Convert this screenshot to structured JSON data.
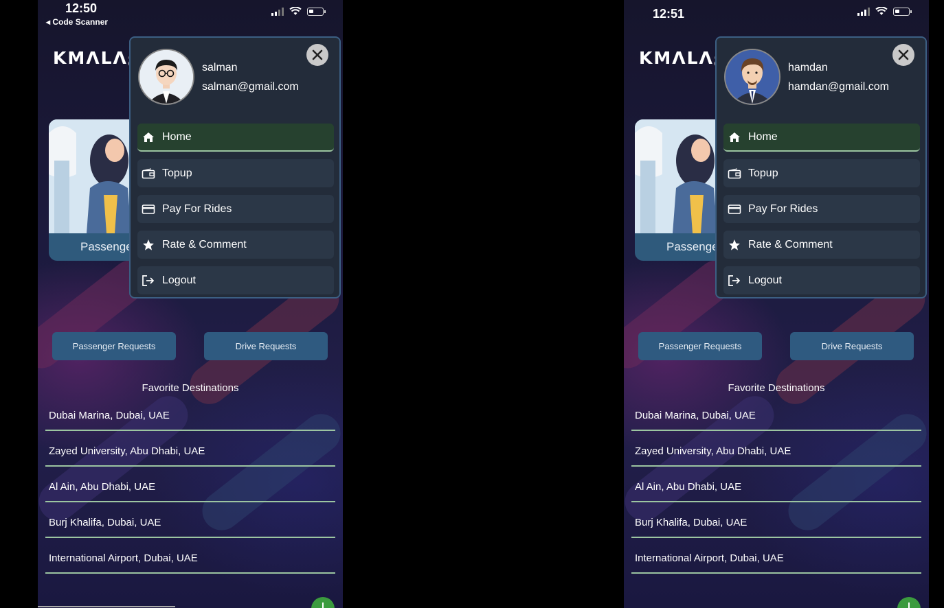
{
  "screens": [
    {
      "status": {
        "time": "12:50",
        "back_label": "◂ Code Scanner"
      },
      "logo": "KMɅLɅꜫ",
      "card_label": "Passenger",
      "drawer": {
        "user_name": "salman",
        "user_email": "salman@gmail.com",
        "close_icon": "close-icon",
        "menu": [
          {
            "label": "Home",
            "icon": "home-icon",
            "active": true
          },
          {
            "label": "Topup",
            "icon": "wallet-icon"
          },
          {
            "label": "Pay For Rides",
            "icon": "credit-card-icon"
          },
          {
            "label": "Rate & Comment",
            "icon": "star-icon"
          },
          {
            "label": "Logout",
            "icon": "logout-icon"
          }
        ]
      },
      "buttons": {
        "passenger_requests": "Passenger Requests",
        "drive_requests": "Drive Requests"
      },
      "favorites_title": "Favorite Destinations",
      "favorites": [
        "Dubai Marina, Dubai, UAE",
        "Zayed University, Abu Dhabi, UAE",
        "Al Ain, Abu Dhabi, UAE",
        "Burj Khalifa, Dubai, UAE",
        "International Airport, Dubai, UAE"
      ]
    },
    {
      "status": {
        "time": "12:51",
        "back_label": ""
      },
      "logo": "KMɅLɅꜫ",
      "card_label": "Passenger",
      "drawer": {
        "user_name": "hamdan",
        "user_email": "hamdan@gmail.com",
        "close_icon": "close-icon",
        "menu": [
          {
            "label": "Home",
            "icon": "home-icon",
            "active": true
          },
          {
            "label": "Topup",
            "icon": "wallet-icon"
          },
          {
            "label": "Pay For Rides",
            "icon": "credit-card-icon"
          },
          {
            "label": "Rate & Comment",
            "icon": "star-icon"
          },
          {
            "label": "Logout",
            "icon": "logout-icon"
          }
        ]
      },
      "buttons": {
        "passenger_requests": "Passenger Requests",
        "drive_requests": "Drive Requests"
      },
      "favorites_title": "Favorite Destinations",
      "favorites": [
        "Dubai Marina, Dubai, UAE",
        "Zayed University, Abu Dhabi, UAE",
        "Al Ain, Abu Dhabi, UAE",
        "Burj Khalifa, Dubai, UAE",
        "International Airport, Dubai, UAE"
      ]
    }
  ],
  "colors": {
    "accent_line": "#9cc5a1",
    "button": "#2f5a80",
    "drawer_bg": "#232c3a",
    "drawer_border": "#3c5f83",
    "fab": "#3b9b3e"
  }
}
